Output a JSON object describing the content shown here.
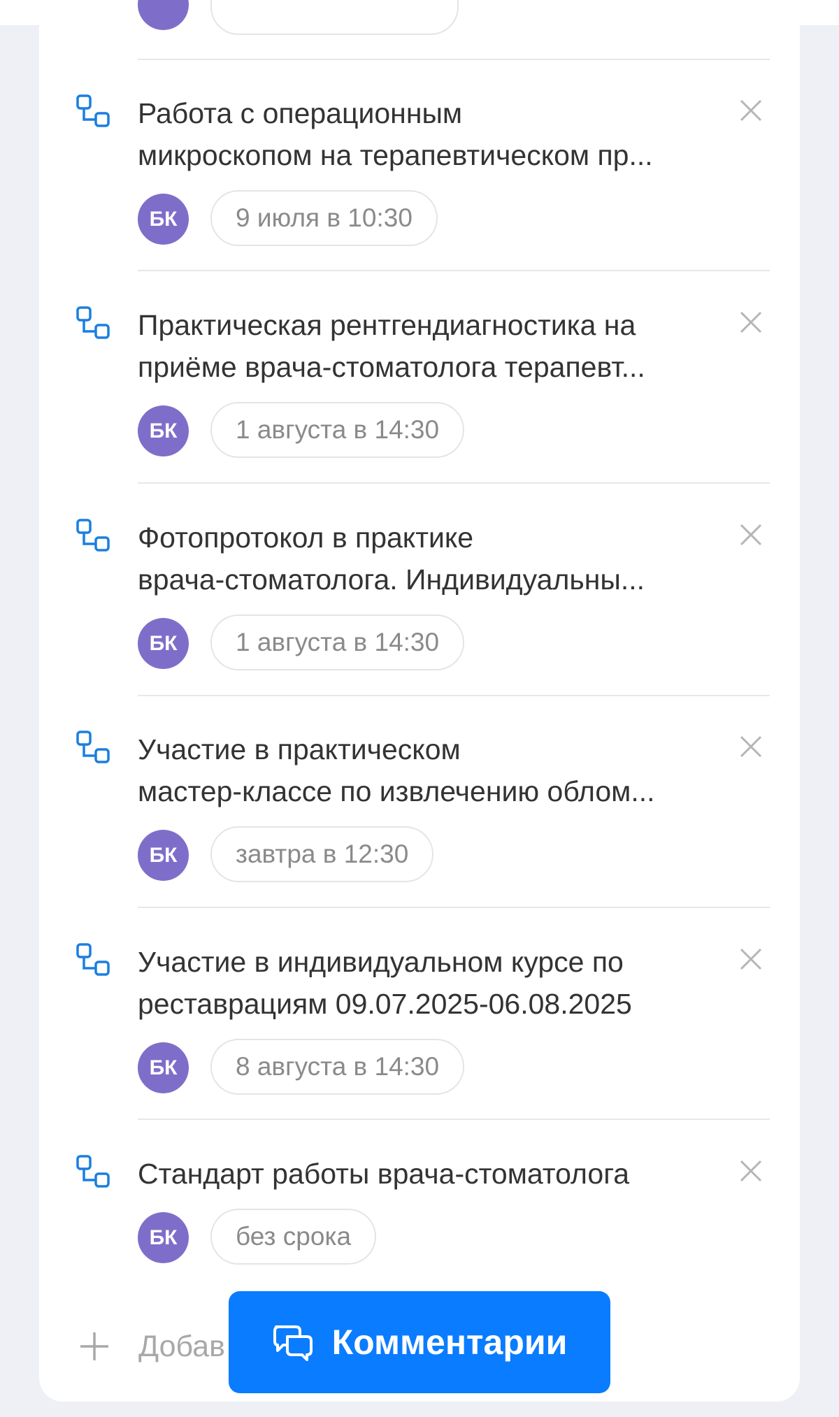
{
  "colors": {
    "accent": "#0a7cff",
    "avatar": "#7f6ec9",
    "icon_blue": "#1a7fe0"
  },
  "tasks": [
    {
      "title_line1": "Работа с операционным",
      "title_line2": "микроскопом на терапевтическом пр...",
      "avatar": "БК",
      "due": "9 июля в 10:30"
    },
    {
      "title_line1": "Практическая рентгендиагностика на",
      "title_line2": "приёме врача-стоматолога терапевт...",
      "avatar": "БК",
      "due": "1 августа в 14:30"
    },
    {
      "title_line1": "Фотопротокол в практике",
      "title_line2": "врача-стоматолога. Индивидуальны...",
      "avatar": "БК",
      "due": "1 августа в 14:30"
    },
    {
      "title_line1": "Участие в практическом",
      "title_line2": "мастер-классе по извлечению облом...",
      "avatar": "БК",
      "due": "завтра в 12:30"
    },
    {
      "title_line1": "Участие в индивидуальном курсе по",
      "title_line2": "реставрациям 09.07.2025-06.08.2025",
      "avatar": "БК",
      "due": "8 августа в 14:30"
    },
    {
      "title_line1": "Стандарт работы врача-стоматолога",
      "title_line2": "",
      "avatar": "БК",
      "due": "без срока"
    }
  ],
  "add_label": "Добав",
  "comments_button": "Комментарии",
  "icons": {
    "task": "subtask-icon",
    "close": "close-icon",
    "add": "plus-icon",
    "comments": "chat-bubbles-icon"
  }
}
